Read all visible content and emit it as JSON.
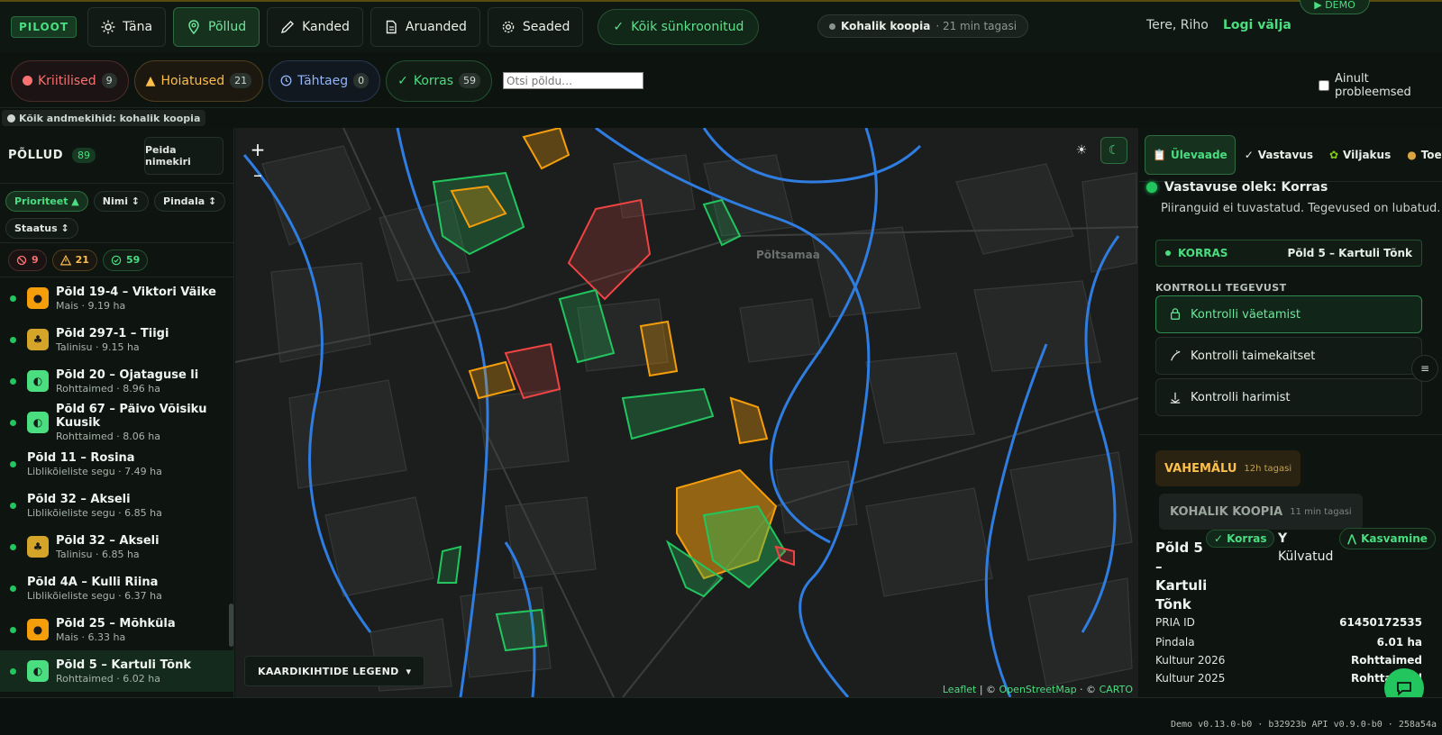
{
  "header": {
    "brand": "PILOOT",
    "nav": [
      {
        "label": "Täna",
        "icon": "sun-icon"
      },
      {
        "label": "Põllud",
        "icon": "map-pin-icon"
      },
      {
        "label": "Kanded",
        "icon": "pencil-icon"
      },
      {
        "label": "Aruanded",
        "icon": "document-icon"
      },
      {
        "label": "Seaded",
        "icon": "gear-icon"
      }
    ],
    "sync": "Kõik sünkroonitud",
    "local_copy": {
      "label": "Kohalik koopia",
      "age": "· 21 min tagasi"
    },
    "greeting": "Tere, Riho",
    "logout": "Logi välja",
    "demo": "▶ DEMO"
  },
  "filters": {
    "critical": {
      "label": "Kriitilised",
      "count": "9"
    },
    "warnings": {
      "label": "Hoiatused",
      "count": "21"
    },
    "deadline": {
      "label": "Tähtaeg",
      "count": "0"
    },
    "ok": {
      "label": "Korras",
      "count": "59"
    },
    "search_placeholder": "Otsi põldu…",
    "only_problems": "Ainult probleemsed"
  },
  "offline_notice": "Kõik andmekihid: kohalik koopia",
  "sidebar": {
    "title": "PÕLLUD",
    "count": "89",
    "hide_button": "Peida nimekiri",
    "sorts": [
      "Prioriteet ▲",
      "Nimi ↕",
      "Pindala ↕",
      "Staatus ↕"
    ],
    "counters": {
      "red": "9",
      "yellow": "21",
      "green": "59"
    },
    "fields": [
      {
        "name": "Põld 19-4 – Viktori Väike",
        "sub": "Mais · 9.19 ha",
        "crop": "mais"
      },
      {
        "name": "Põld 297-1 – Tiigi",
        "sub": "Talinisu · 9.15 ha",
        "crop": "tali"
      },
      {
        "name": "Põld 20 – Ojataguse li",
        "sub": "Rohttaimed · 8.96 ha",
        "crop": "roht"
      },
      {
        "name": "Põld 67 – Päivo Võisiku Kuusik",
        "sub": "Rohttaimed · 8.06 ha",
        "crop": "roht"
      },
      {
        "name": "Põld 11 – Rosina",
        "sub": "Liblikõieliste segu · 7.49 ha",
        "crop": ""
      },
      {
        "name": "Põld 32 – Akseli",
        "sub": "Liblikõieliste segu · 6.85 ha",
        "crop": ""
      },
      {
        "name": "Põld 32 – Akseli",
        "sub": "Talinisu · 6.85 ha",
        "crop": "tali"
      },
      {
        "name": "Põld 4A – Kulli Riina",
        "sub": "Liblikõieliste segu · 6.37 ha",
        "crop": ""
      },
      {
        "name": "Põld 25 – Mõhküla",
        "sub": "Mais · 6.33 ha",
        "crop": "mais"
      },
      {
        "name": "Põld 5 – Kartuli Tõnk",
        "sub": "Rohttaimed · 6.02 ha",
        "crop": "roht"
      }
    ]
  },
  "map": {
    "place": "Põltsamaa",
    "legend": "KAARDIKIHTIDE LEGEND",
    "attribution": {
      "leaflet": "Leaflet",
      "sep1": " | © ",
      "osm": "OpenStreetMap",
      "sep2": " · © ",
      "carto": "CARTO"
    }
  },
  "panel": {
    "tabs": [
      {
        "label": "Ülevaade",
        "icon": "clipboard-icon"
      },
      {
        "label": "Vastavus",
        "icon": "check-icon"
      },
      {
        "label": "Viljakus",
        "icon": "sprout-icon"
      },
      {
        "label": "Toetused",
        "icon": "money-bag-icon"
      }
    ],
    "status_title": "Vastavuse olek: Korras",
    "status_desc": "Piiranguid ei tuvastatud. Tegevused on lubatud.",
    "ok_label": "KORRAS",
    "ok_field": "Põld 5 – Kartuli Tõnk",
    "check_title": "KONTROLLI TEGEVUST",
    "actions": [
      "Kontrolli väetamist",
      "Kontrolli taimekaitset",
      "Kontrolli harimist"
    ],
    "cache": {
      "label": "VAHEMÄLU",
      "age": "12h tagasi"
    },
    "local": {
      "label": "KOHALIK KOOPIA",
      "age": "11 min tagasi"
    },
    "field_name": "Põld 5 – Kartuli Tõnk",
    "field_badge": "Korras",
    "sown_y": "Y",
    "sown": "Külvatud",
    "growth": "Kasvamine",
    "props": [
      {
        "k": "PRIA ID",
        "v": "61450172535"
      },
      {
        "k": "Pindala",
        "v": "6.01 ha"
      },
      {
        "k": "Kultuur 2026",
        "v": "Rohttaimed"
      },
      {
        "k": "Kultuur 2025",
        "v": "Rohttaimed"
      }
    ]
  },
  "footer": {
    "version": "Demo v0.13.0-b0 · b32923b  API v0.9.0-b0 · 258a54a"
  },
  "colors": {
    "accent": "#4ade80",
    "critical": "#f87171",
    "warning": "#fbbf4a",
    "water": "#3b82f6"
  }
}
